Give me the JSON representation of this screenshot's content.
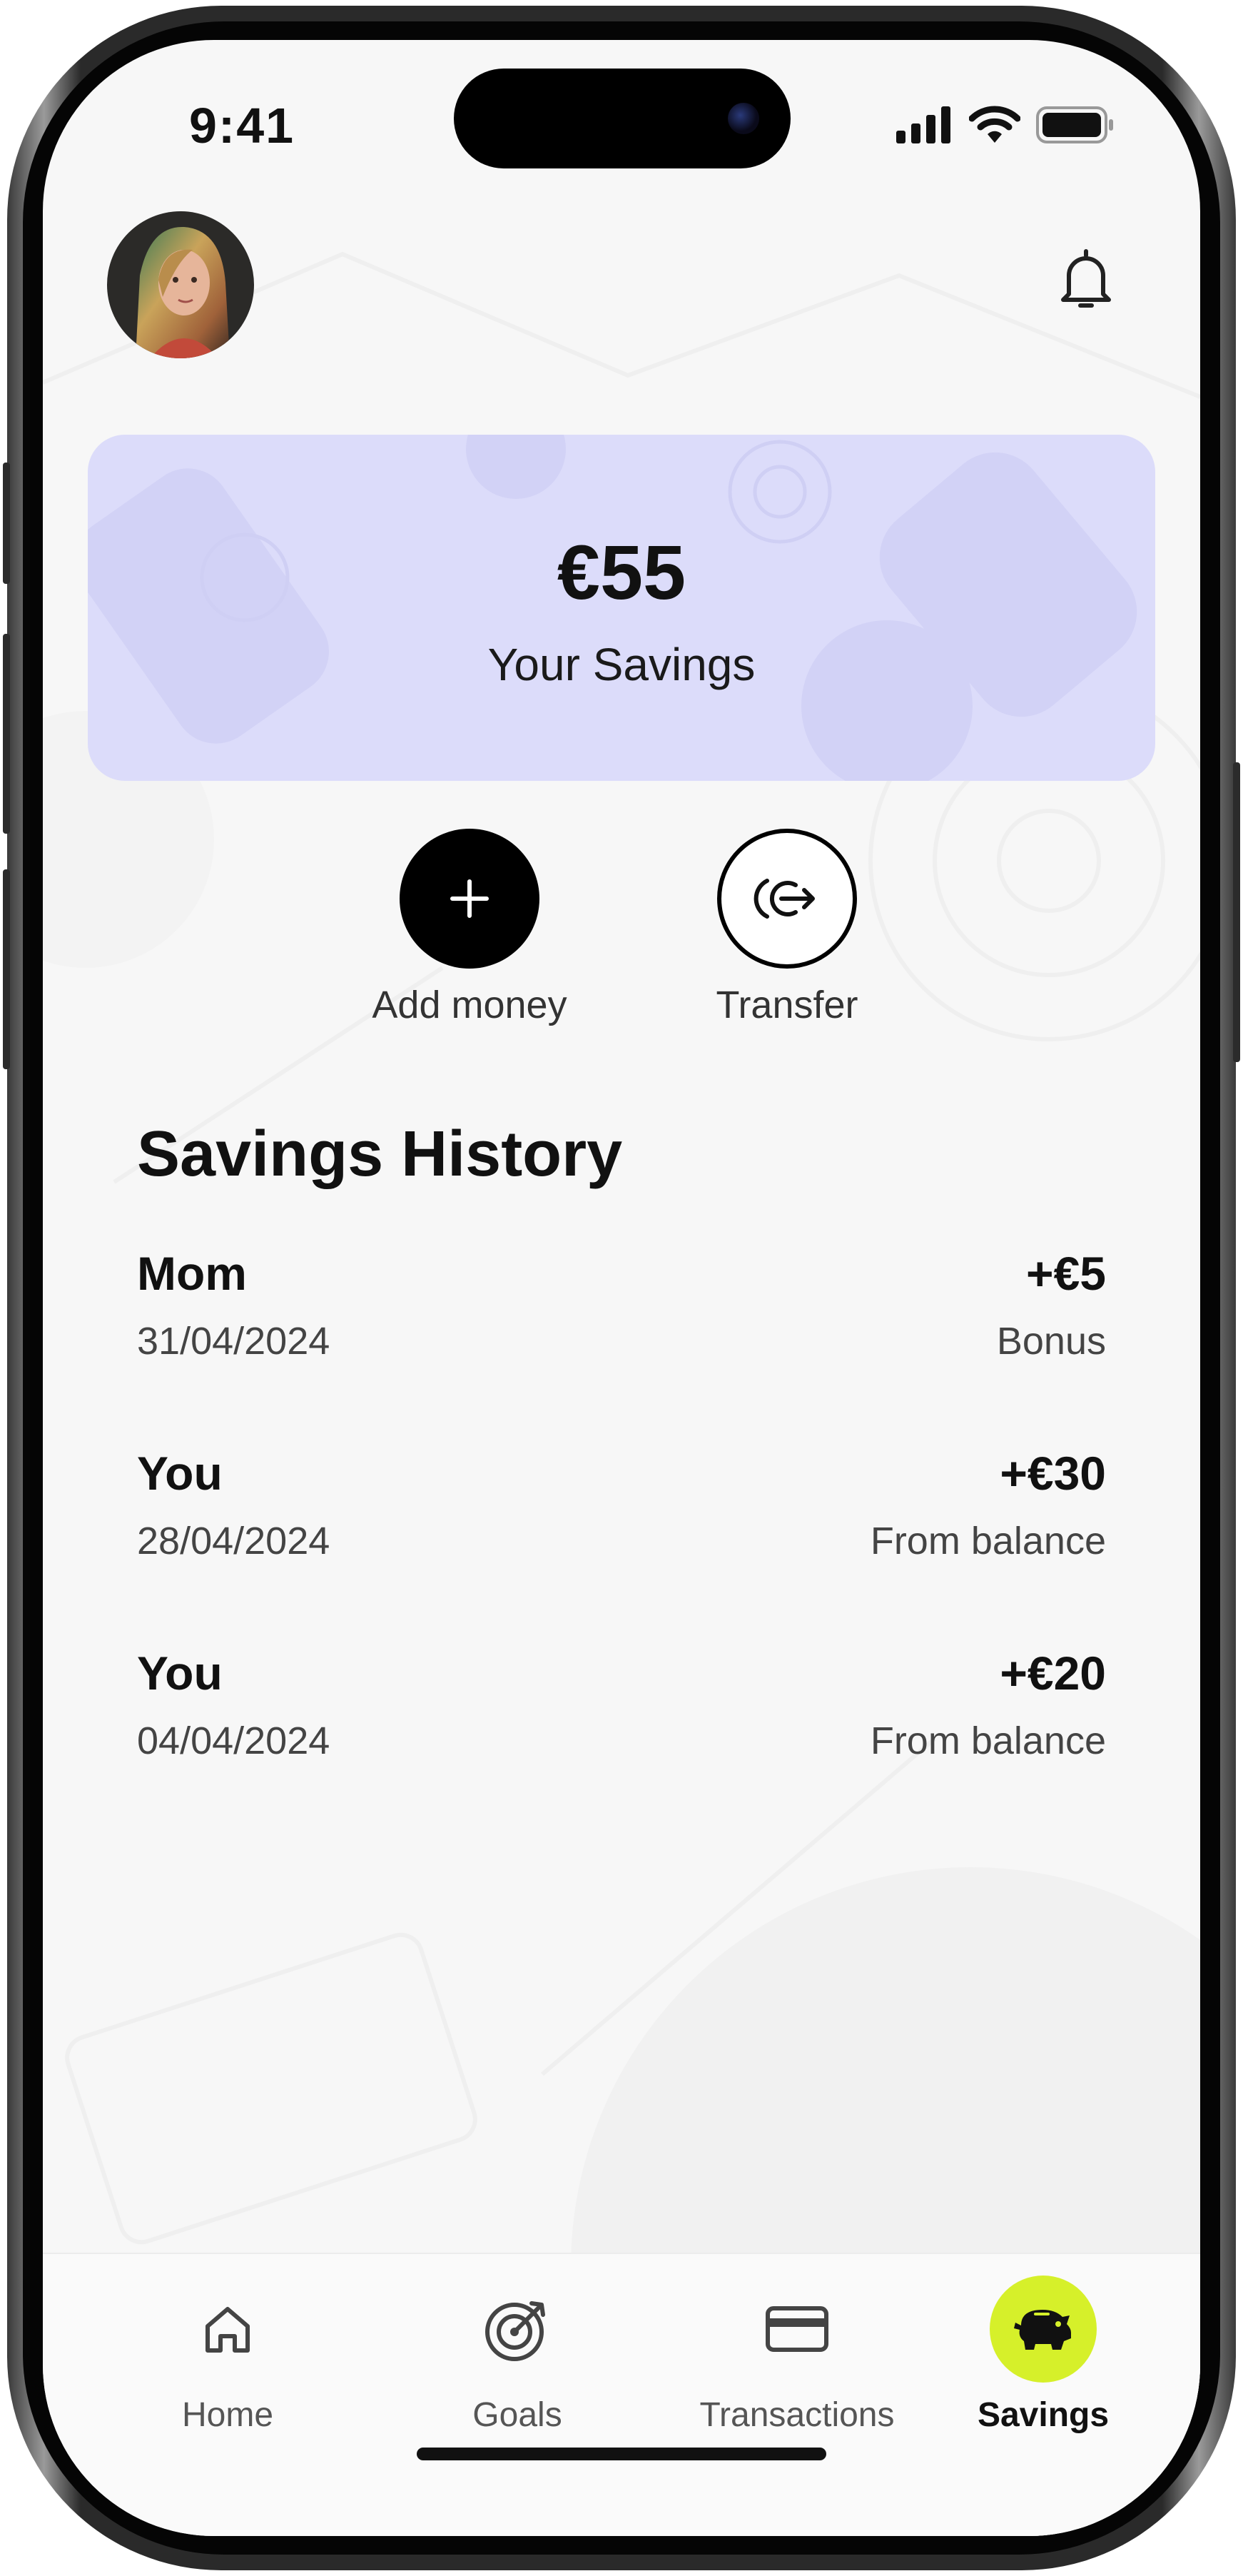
{
  "status_bar": {
    "time": "9:41"
  },
  "header": {
    "avatar_icon": "user-avatar",
    "notification_icon": "bell-icon"
  },
  "savings_card": {
    "amount": "€55",
    "label": "Your Savings",
    "background_color": "#dcdcfa"
  },
  "actions": [
    {
      "label": "Add money",
      "icon": "plus-icon"
    },
    {
      "label": "Transfer",
      "icon": "transfer-icon"
    }
  ],
  "history": {
    "title": "Savings History",
    "rows": [
      {
        "who": "Mom",
        "date": "31/04/2024",
        "amount": "+€5",
        "source": "Bonus"
      },
      {
        "who": "You",
        "date": "28/04/2024",
        "amount": "+€30",
        "source": "From balance"
      },
      {
        "who": "You",
        "date": "04/04/2024",
        "amount": "+€20",
        "source": "From balance"
      }
    ]
  },
  "bottom_nav": {
    "active_color": "#d6f02a",
    "items": [
      {
        "label": "Home",
        "icon": "home-icon"
      },
      {
        "label": "Goals",
        "icon": "target-icon"
      },
      {
        "label": "Transactions",
        "icon": "card-icon"
      },
      {
        "label": "Savings",
        "icon": "piggy-bank-icon",
        "active": true
      }
    ]
  }
}
